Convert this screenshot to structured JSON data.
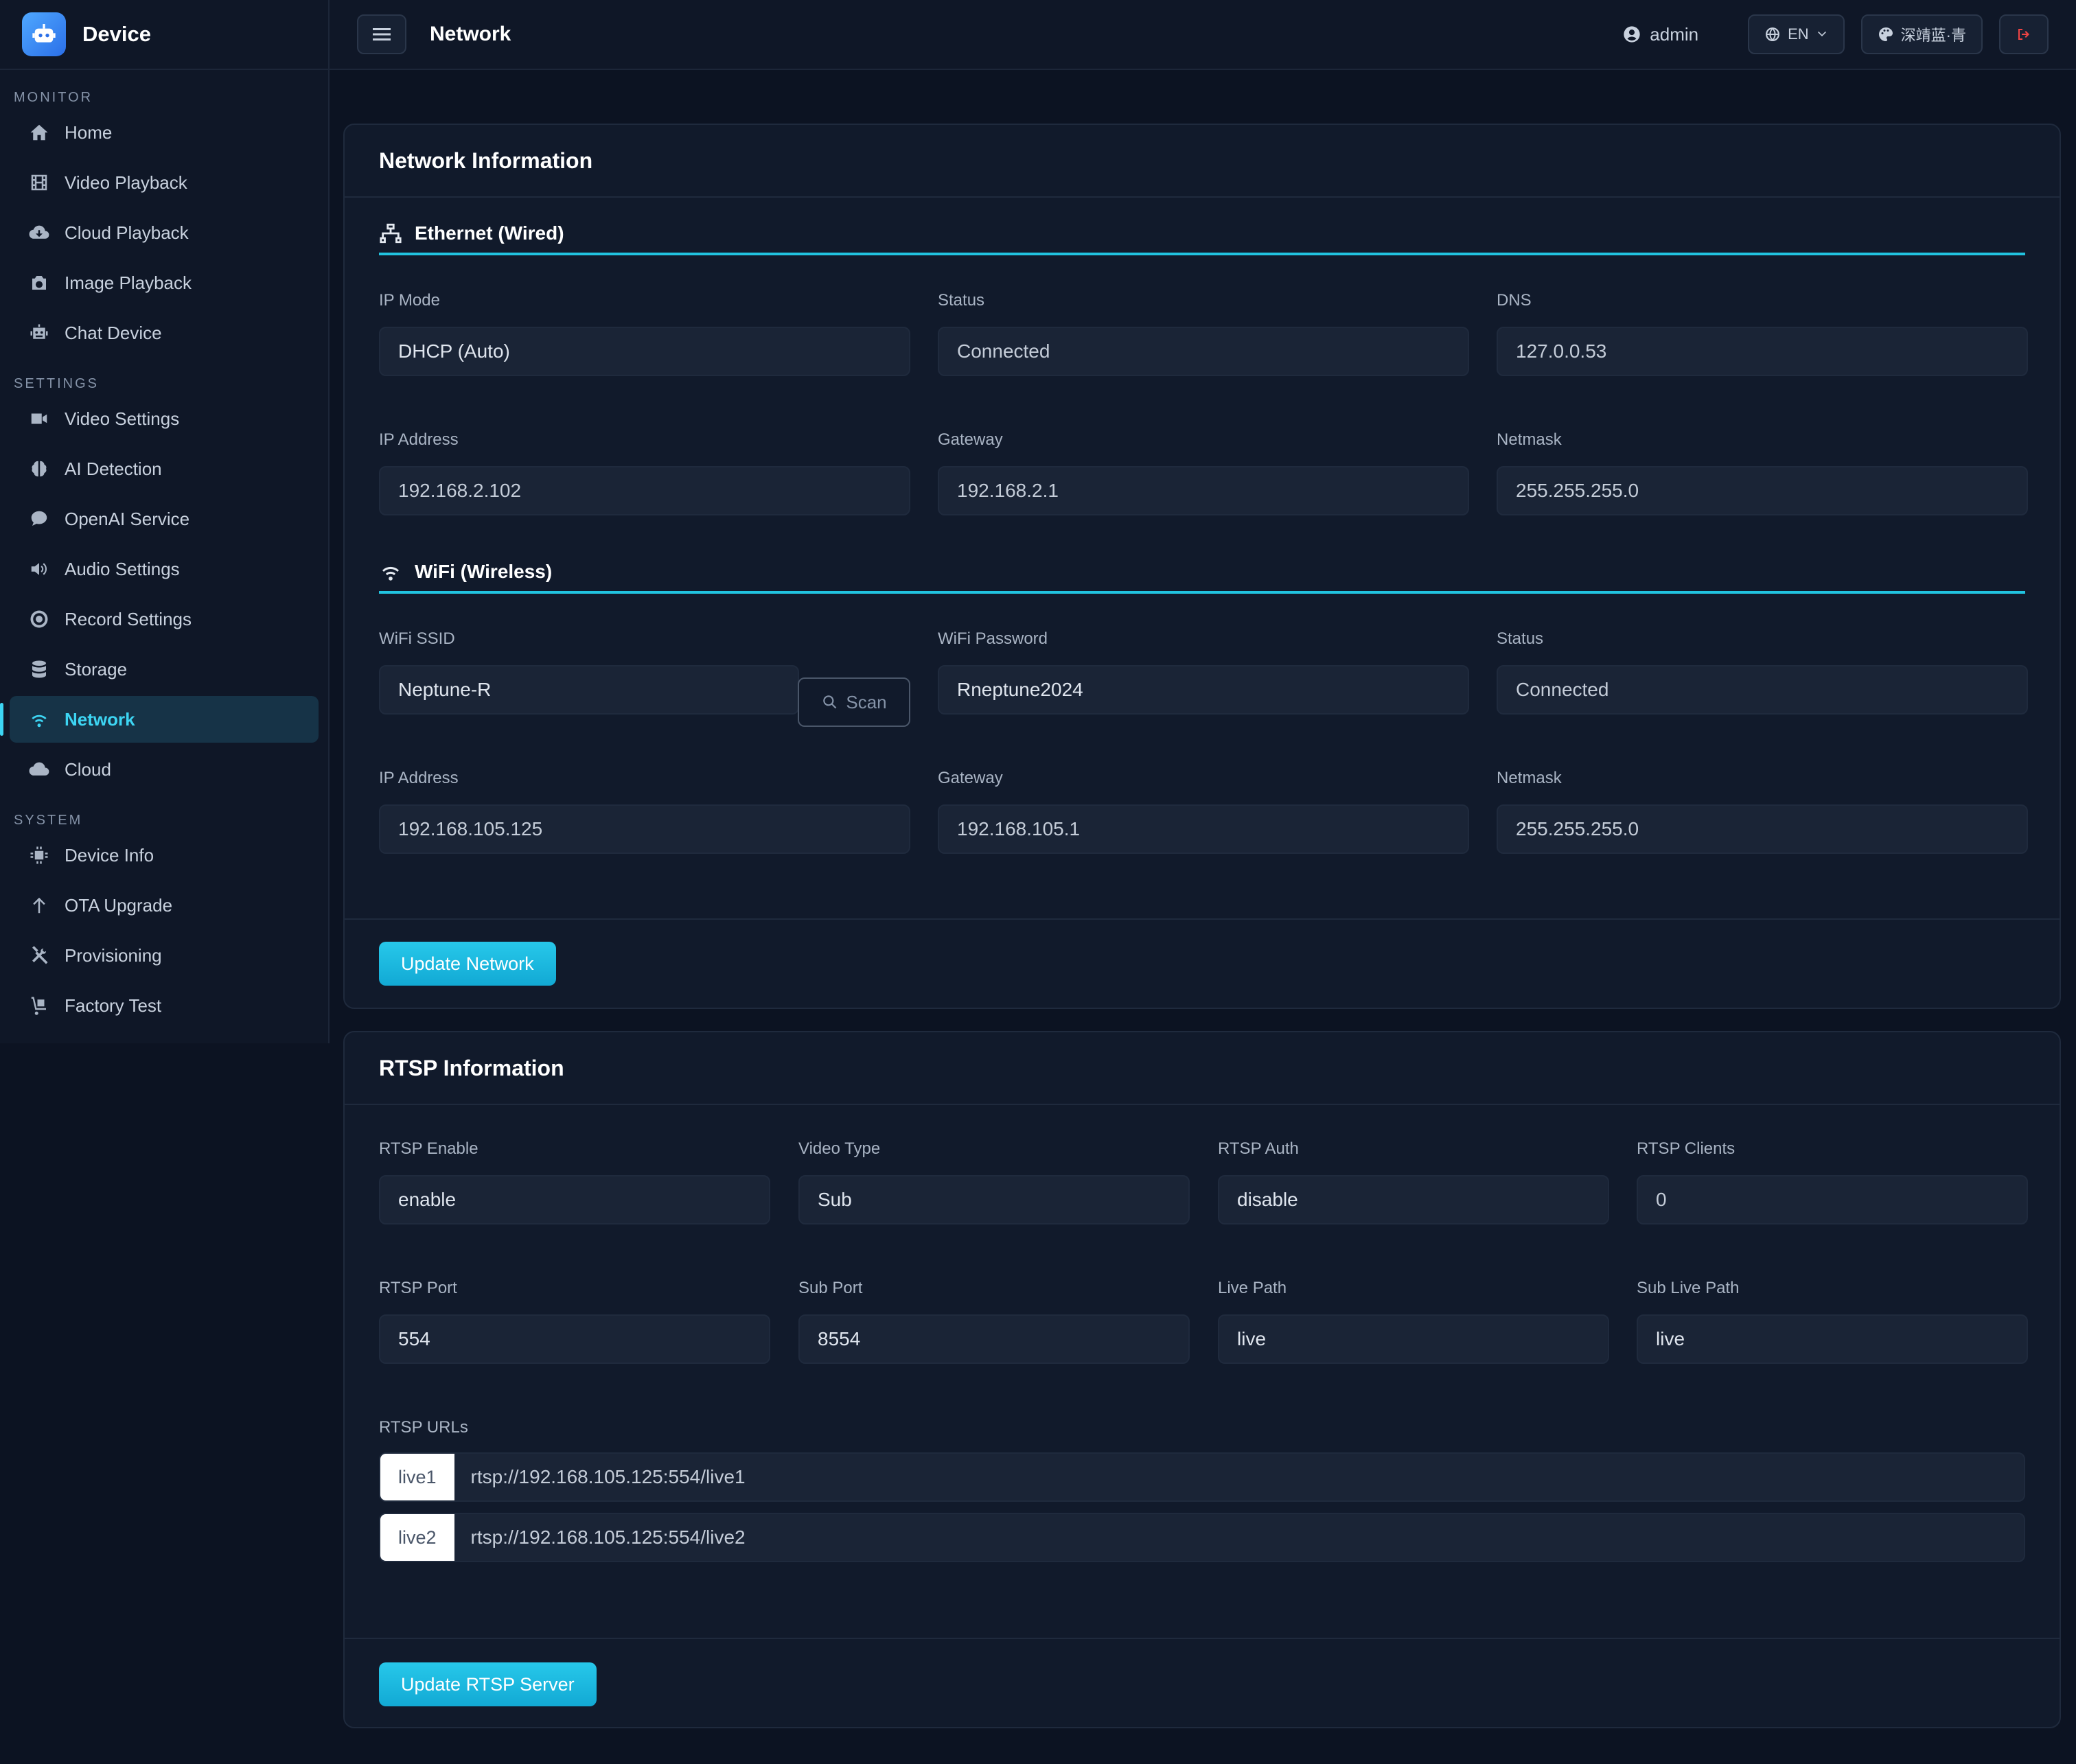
{
  "brand": {
    "name": "Device"
  },
  "sidebar": {
    "sections": [
      {
        "title": "MONITOR",
        "items": [
          {
            "label": "Home",
            "icon": "home-icon"
          },
          {
            "label": "Video Playback",
            "icon": "film-icon"
          },
          {
            "label": "Cloud Playback",
            "icon": "cloud-download-icon"
          },
          {
            "label": "Image Playback",
            "icon": "camera-icon"
          },
          {
            "label": "Chat Device",
            "icon": "robot-icon"
          }
        ]
      },
      {
        "title": "SETTINGS",
        "items": [
          {
            "label": "Video Settings",
            "icon": "video-icon"
          },
          {
            "label": "AI Detection",
            "icon": "brain-icon"
          },
          {
            "label": "OpenAI Service",
            "icon": "chat-bubble-icon"
          },
          {
            "label": "Audio Settings",
            "icon": "speaker-icon"
          },
          {
            "label": "Record Settings",
            "icon": "record-icon"
          },
          {
            "label": "Storage",
            "icon": "database-icon"
          },
          {
            "label": "Network",
            "icon": "wifi-icon",
            "active": true
          },
          {
            "label": "Cloud",
            "icon": "cloud-icon"
          }
        ]
      },
      {
        "title": "SYSTEM",
        "items": [
          {
            "label": "Device Info",
            "icon": "chip-icon"
          },
          {
            "label": "OTA Upgrade",
            "icon": "arrow-up-icon"
          },
          {
            "label": "Provisioning",
            "icon": "tools-icon"
          },
          {
            "label": "Factory Test",
            "icon": "dolly-icon"
          }
        ]
      }
    ]
  },
  "header": {
    "title": "Network",
    "user": "admin",
    "language": "EN",
    "theme": "深靖蓝·青"
  },
  "network": {
    "title": "Network Information",
    "ethernet": {
      "title": "Ethernet (Wired)",
      "ip_mode_label": "IP Mode",
      "ip_mode": "DHCP (Auto)",
      "status_label": "Status",
      "status": "Connected",
      "dns_label": "DNS",
      "dns": "127.0.0.53",
      "ip_label": "IP Address",
      "ip": "192.168.2.102",
      "gateway_label": "Gateway",
      "gateway": "192.168.2.1",
      "netmask_label": "Netmask",
      "netmask": "255.255.255.0"
    },
    "wifi": {
      "title": "WiFi (Wireless)",
      "ssid_label": "WiFi SSID",
      "ssid": "Neptune-R",
      "scan_label": "Scan",
      "password_label": "WiFi Password",
      "password": "Rneptune2024",
      "status_label": "Status",
      "status": "Connected",
      "ip_label": "IP Address",
      "ip": "192.168.105.125",
      "gateway_label": "Gateway",
      "gateway": "192.168.105.1",
      "netmask_label": "Netmask",
      "netmask": "255.255.255.0"
    },
    "update_label": "Update Network"
  },
  "rtsp": {
    "title": "RTSP Information",
    "enable_label": "RTSP Enable",
    "enable": "enable",
    "video_type_label": "Video Type",
    "video_type": "Sub",
    "auth_label": "RTSP Auth",
    "auth": "disable",
    "clients_label": "RTSP Clients",
    "clients": "0",
    "port_label": "RTSP Port",
    "port": "554",
    "sub_port_label": "Sub Port",
    "sub_port": "8554",
    "live_path_label": "Live Path",
    "live_path": "live",
    "sub_live_path_label": "Sub Live Path",
    "sub_live_path": "live",
    "urls_label": "RTSP URLs",
    "urls": [
      {
        "tag": "live1",
        "url": "rtsp://192.168.105.125:554/live1"
      },
      {
        "tag": "live2",
        "url": "rtsp://192.168.105.125:554/live2"
      }
    ],
    "update_label": "Update RTSP Server"
  }
}
